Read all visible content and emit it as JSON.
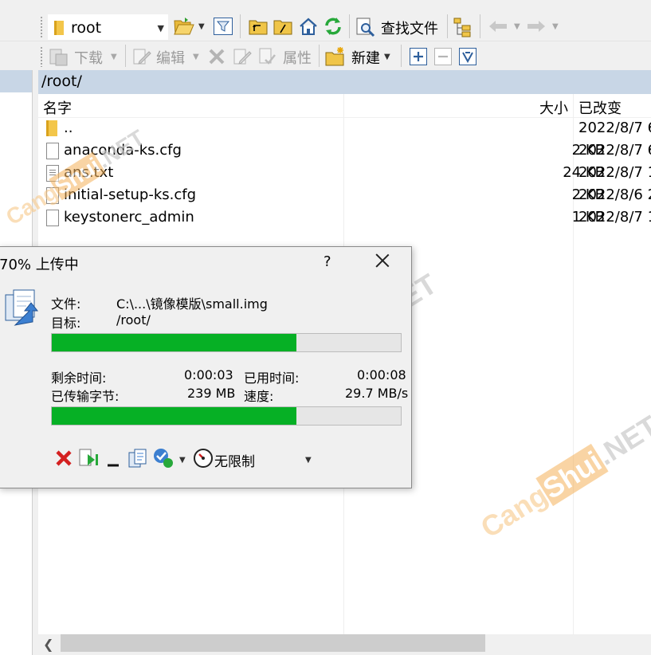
{
  "toolbar_top": {
    "path_combo_value": "root",
    "find_files_label": "查找文件"
  },
  "toolbar_bottom": {
    "download_label": "下载",
    "edit_label": "编辑",
    "properties_label": "属性",
    "new_label": "新建"
  },
  "remote_panel": {
    "path": "/root/",
    "columns": {
      "name": "名字",
      "size": "大小",
      "changed": "已改变"
    },
    "files": [
      {
        "name": "..",
        "size": "",
        "changed": "2022/8/7 6",
        "icon": "parent-dir-icon"
      },
      {
        "name": "anaconda-ks.cfg",
        "size": "2 KB",
        "changed": "2022/8/7 6",
        "icon": "file-icon"
      },
      {
        "name": "ans.txt",
        "size": "24 KB",
        "changed": "2022/8/7 1",
        "icon": "text-file-icon"
      },
      {
        "name": "initial-setup-ks.cfg",
        "size": "2 KB",
        "changed": "2022/8/6 2",
        "icon": "file-icon"
      },
      {
        "name": "keystonerc_admin",
        "size": "1 KB",
        "changed": "2022/8/7 1",
        "icon": "file-icon"
      }
    ]
  },
  "dialog": {
    "title": "70% 上传中",
    "help": "?",
    "file_label": "文件:",
    "file_value": "C:\\...\\镜像模版\\small.img",
    "target_label": "目标:",
    "target_value": "/root/",
    "file_progress": 0.7,
    "remaining_time_label": "剩余时间:",
    "remaining_time_value": "0:00:03",
    "elapsed_time_label": "已用时间:",
    "elapsed_time_value": "0:00:08",
    "bytes_transferred_label": "已传输字节:",
    "bytes_transferred_value": "239 MB",
    "speed_label": "速度:",
    "speed_value": "29.7 MB/s",
    "total_progress": 0.7,
    "speed_limit_label": "无限制"
  },
  "watermarks": [
    "CangShui.NET",
    "CangShui.NET",
    "CangShui.NET"
  ],
  "colors": {
    "panel_header": "#c8d6e6",
    "progress_fill": "#06b025",
    "watermark_orange": "#f5a623"
  }
}
